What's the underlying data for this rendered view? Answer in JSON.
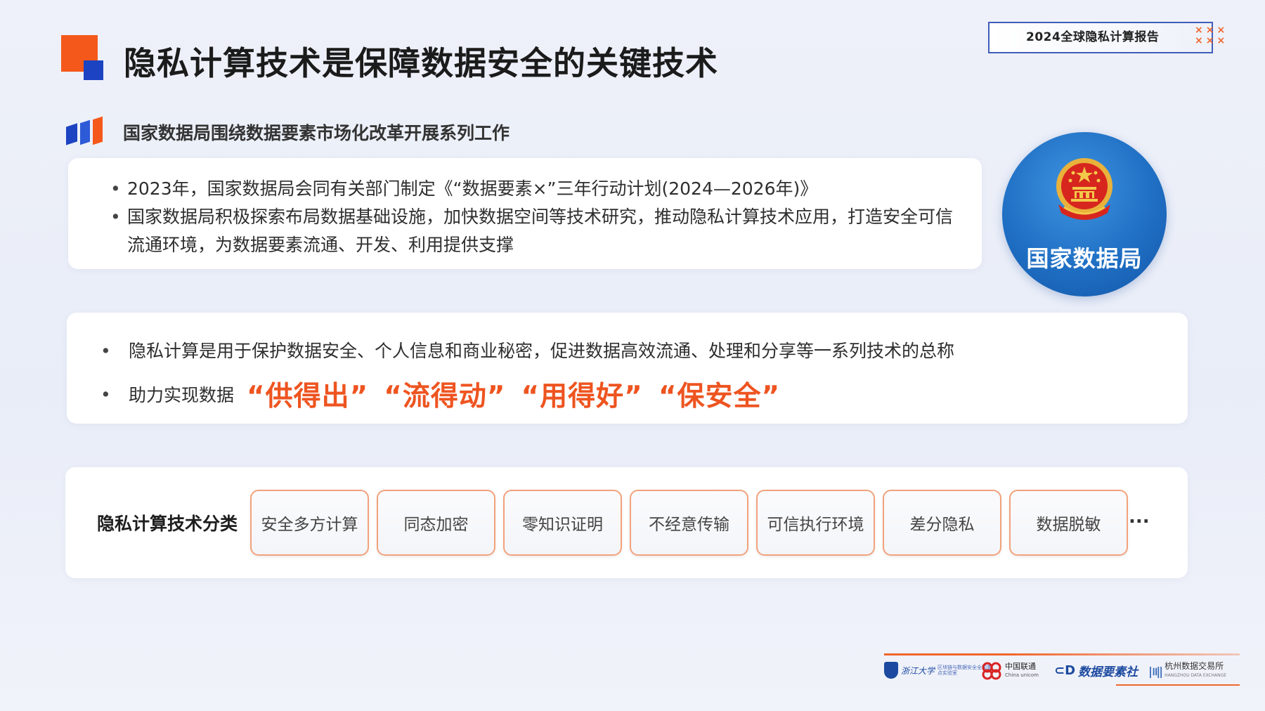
{
  "header": {
    "title": "隐私计算技术是保障数据安全的关键技术",
    "report_badge": "2024全球隐私计算报告",
    "badge_marks": "×××\n×××",
    "colors": {
      "accent_orange": "#f5581b",
      "accent_blue": "#1c43c2",
      "highlight": "#ee5420"
    }
  },
  "section": {
    "subtitle": "国家数据局围绕数据要素市场化改革开展系列工作"
  },
  "card1": {
    "bullets": [
      "2023年，国家数据局会同有关部门制定《“数据要素×”三年行动计划(2024—2026年)》",
      "国家数据局积极探索布局数据基础设施，加快数据空间等技术研究，推动隐私计算技术应用，打造安全可信流通环境，为数据要素流通、开发、利用提供支撑"
    ]
  },
  "emblem": {
    "label": "国家数据局",
    "icon": "national-emblem-icon"
  },
  "card2": {
    "bullet_char": "•",
    "line1": "隐私计算是用于保护数据安全、个人信息和商业秘密，促进数据高效流通、处理和分享等一系列技术的总称",
    "line2_prefix": "助力实现数据",
    "highlights": [
      "“供得出”",
      "“流得动”",
      "“用得好”",
      "“保安全”"
    ]
  },
  "card3": {
    "label": "隐私计算技术分类",
    "tags": [
      "安全多方计算",
      "同态加密",
      "零知识证明",
      "不经意传输",
      "可信执行环境",
      "差分隐私",
      "数据脱敏"
    ],
    "ellipsis": "..."
  },
  "partners": {
    "zju": "浙江大学",
    "zju_sub": "区块链与数据安全全国重点实验室",
    "unicom": "中国联通",
    "unicom_en": "China unicom",
    "sjys": "数据要素社",
    "hz": "杭州数据交易所",
    "hz_en": "HANGZHOU DATA EXCHANGE"
  }
}
